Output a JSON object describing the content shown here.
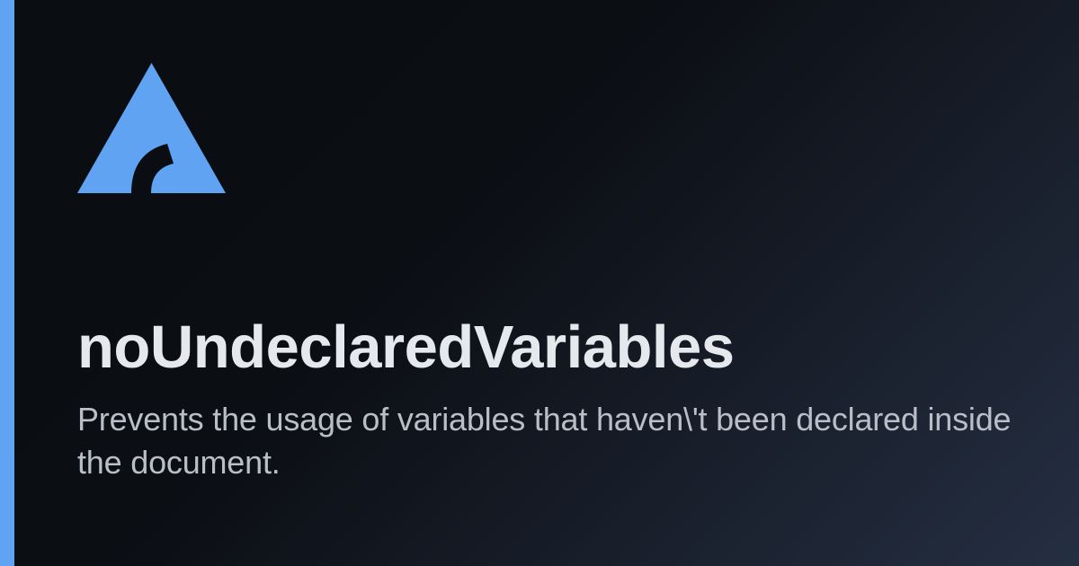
{
  "accent_color": "#5fa3f2",
  "logo": {
    "name": "triangle-logo",
    "fill_color": "#5fa3f2",
    "inner_color": "#0a0d12"
  },
  "title": "noUndeclaredVariables",
  "description": "Prevents the usage of variables that haven\\'t been declared inside the document."
}
